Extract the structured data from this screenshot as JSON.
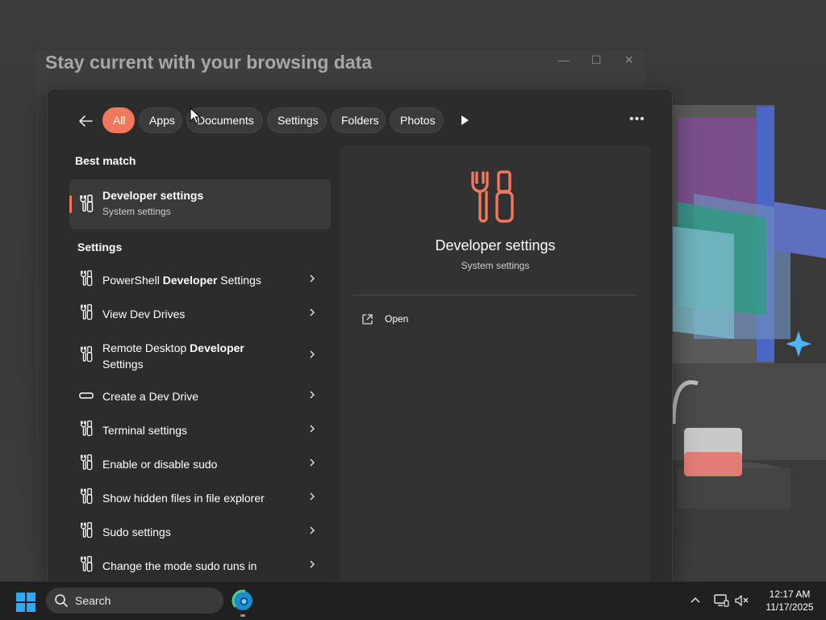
{
  "background": {
    "window_title": "Stay current with your browsing data",
    "window_controls": {
      "minimize": "—",
      "maximize": "☐",
      "close": "✕"
    }
  },
  "search_flyout": {
    "back_icon": "back-arrow-icon",
    "filters": [
      {
        "label": "All",
        "active": true
      },
      {
        "label": "Apps",
        "active": false
      },
      {
        "label": "Documents",
        "active": false
      },
      {
        "label": "Settings",
        "active": false
      },
      {
        "label": "Folders",
        "active": false
      },
      {
        "label": "Photos",
        "active": false
      }
    ],
    "more_label": "•••",
    "best_match": {
      "heading": "Best match",
      "title": "Developer settings",
      "subtitle": "System settings",
      "icon": "developer-tools-icon"
    },
    "settings_section": {
      "heading": "Settings",
      "items": [
        {
          "pre": "PowerShell ",
          "bold": "Developer",
          "post": " Settings",
          "icon": "developer-tools-icon"
        },
        {
          "pre": "View Dev Drives",
          "bold": "",
          "post": "",
          "icon": "developer-tools-icon"
        },
        {
          "pre": "Remote Desktop ",
          "bold": "Developer",
          "post": " Settings",
          "icon": "developer-tools-icon"
        },
        {
          "pre": "Create a Dev Drive",
          "bold": "",
          "post": "",
          "icon": "drive-icon"
        },
        {
          "pre": "Terminal settings",
          "bold": "",
          "post": "",
          "icon": "developer-tools-icon"
        },
        {
          "pre": "Enable or disable sudo",
          "bold": "",
          "post": "",
          "icon": "developer-tools-icon"
        },
        {
          "pre": "Show hidden files in file explorer",
          "bold": "",
          "post": "",
          "icon": "developer-tools-icon"
        },
        {
          "pre": "Sudo settings",
          "bold": "",
          "post": "",
          "icon": "developer-tools-icon"
        },
        {
          "pre": "Change the mode sudo runs in",
          "bold": "",
          "post": "",
          "icon": "developer-tools-icon"
        }
      ]
    },
    "preview": {
      "title": "Developer settings",
      "subtitle": "System settings",
      "icon": "developer-tools-icon",
      "accent_color": "#f1785c",
      "actions": [
        {
          "label": "Open",
          "icon": "open-external-icon"
        }
      ]
    }
  },
  "taskbar": {
    "search_placeholder": "Search",
    "time": "12:17 AM",
    "date": "11/17/2025",
    "icons": [
      "start-icon",
      "search-icon",
      "edge-icon",
      "tray-chevron-icon",
      "display-icon",
      "volume-muted-icon"
    ]
  }
}
